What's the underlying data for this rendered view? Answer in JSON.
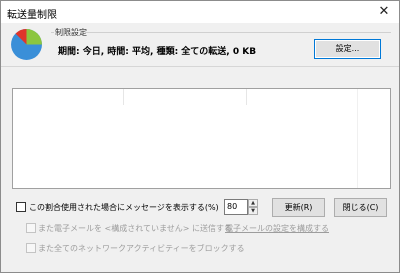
{
  "window": {
    "title": "転送量制限",
    "close_glyph": "✕"
  },
  "settings_panel": {
    "group_label": "制限設定",
    "info_text": "期間: 今日, 時間: 平均, 種類: 全ての転送, 0 KB",
    "settings_button": "設定...",
    "pie_colors": [
      "#3a8fd8",
      "#8cc63f",
      "#e0352b"
    ]
  },
  "graph": {},
  "controls": {
    "show_message_label": "この割合使用された場合にメッセージを表示する(%)",
    "percent_value": "80",
    "refresh_button": "更新(R)",
    "close_button": "閉じる(C)",
    "email_label": "また電子メールを <構成されていません> に送信する",
    "email_link": "電子メールの設定を構成する",
    "block_label": "また全てのネットワークアクティビティーをブロックする"
  }
}
